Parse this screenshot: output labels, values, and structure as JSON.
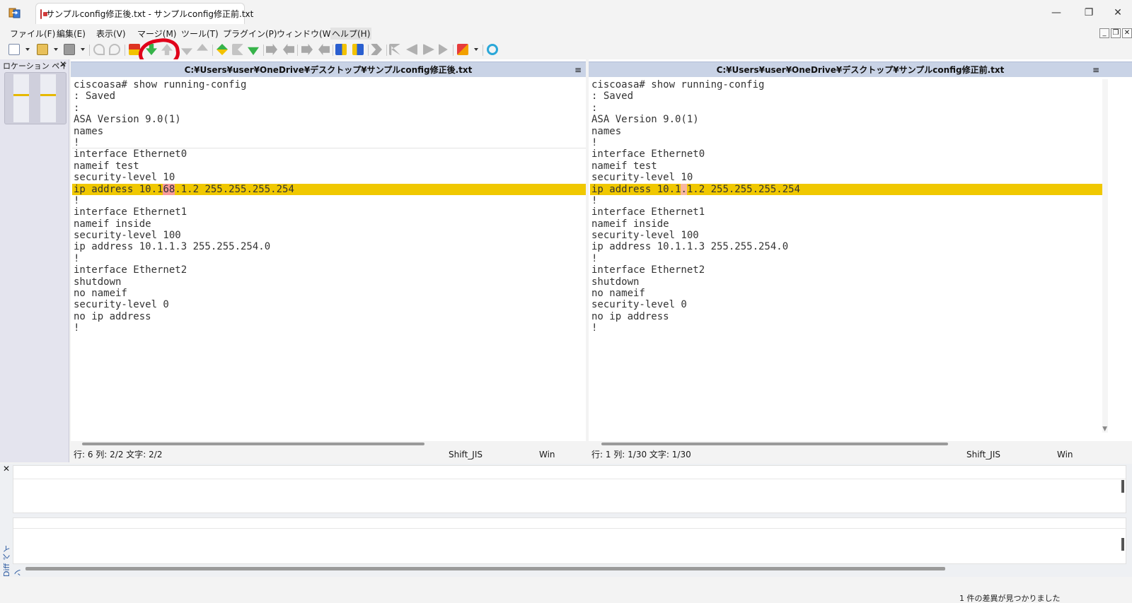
{
  "window": {
    "tab_title": "サンプルconfig修正後.txt - サンプルconfig修正前.txt",
    "minimize": "—",
    "maximize": "❐",
    "close": "✕"
  },
  "menu": [
    "ファイル(F)",
    "編集(E)",
    "表示(V)",
    "マージ(M)",
    "ツール(T)",
    "プラグイン(P)",
    "ウィンドウ(W)",
    "ヘルプ(H)"
  ],
  "mdi": {
    "minimize": "_",
    "restore": "❐",
    "close": "✕"
  },
  "location_pane": {
    "title": "ロケーション ペイン",
    "close": "✕"
  },
  "left_pane": {
    "path": "C:¥Users¥user¥OneDrive¥デスクトップ¥サンプルconfig修正後.txt",
    "lines": [
      "ciscoasa# show running-config",
      ": Saved",
      ":",
      "ASA Version 9.0(1)",
      "names",
      "!",
      "interface Ethernet0",
      "nameif test",
      "security-level 10",
      "ip address 10.1",
      "68",
      ".1.2 255.255.255.254",
      "!",
      "interface Ethernet1",
      "nameif inside",
      "security-level 100",
      "ip address 10.1.1.3 255.255.254.0",
      "!",
      "interface Ethernet2",
      "shutdown",
      "no nameif",
      "security-level 0",
      "no ip address",
      "!"
    ],
    "status": {
      "position": "行: 6  列: 2/2  文字: 2/2",
      "encoding": "Shift_JIS",
      "eol": "Win"
    }
  },
  "right_pane": {
    "path": "C:¥Users¥user¥OneDrive¥デスクトップ¥サンプルconfig修正前.txt",
    "lines": [
      "ciscoasa# show running-config",
      ": Saved",
      ":",
      "ASA Version 9.0(1)",
      "names",
      "!",
      "interface Ethernet0",
      "nameif test",
      "security-level 10",
      "ip address 10.1",
      ".",
      "1.2 255.255.255.254",
      "!",
      "interface Ethernet1",
      "nameif inside",
      "security-level 100",
      "ip address 10.1.1.3 255.255.254.0",
      "!",
      "interface Ethernet2",
      "shutdown",
      "no nameif",
      "security-level 0",
      "no ip address",
      "!"
    ],
    "status": {
      "position": "行: 1  列: 1/30  文字: 1/30",
      "encoding": "Shift_JIS",
      "eol": "Win"
    }
  },
  "header_menu_glyph": "≡",
  "diff_pane": {
    "title": "Diff ペイン",
    "close": "✕"
  },
  "statusbar": {
    "message": "1 件の差異が見つかりました"
  },
  "colors": {
    "changed_line": "#f0c800",
    "changed_char": "#f79a9a",
    "header": "#c9d3e6",
    "annotation": "#e0001a"
  }
}
